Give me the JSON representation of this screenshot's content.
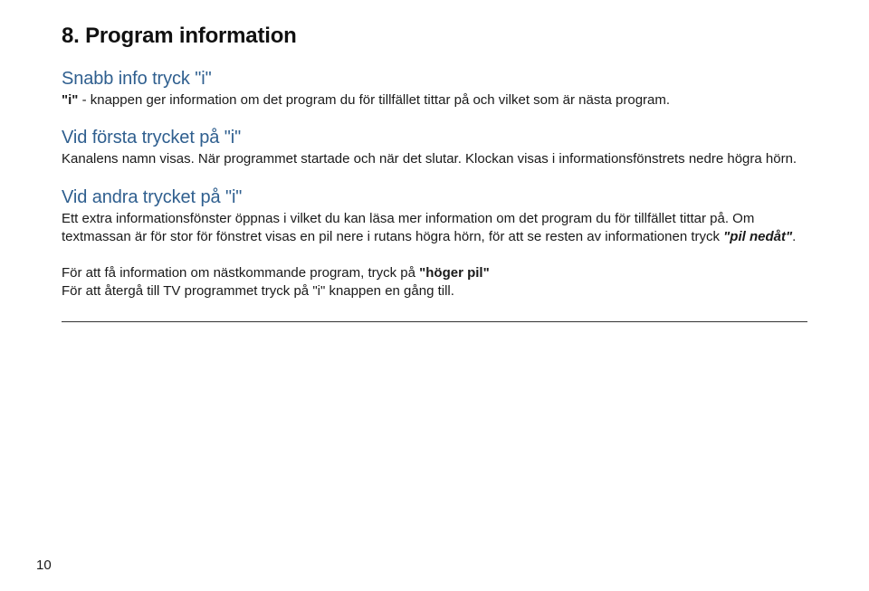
{
  "title": "8. Program information",
  "sections": [
    {
      "heading": "Snabb info tryck \"i\"",
      "body_prefix_bold": "\"i\"",
      "body_rest": " - knappen ger information om det program du för tillfället tittar på och vilket som är nästa program."
    },
    {
      "heading": "Vid första trycket på \"i\"",
      "body": "Kanalens namn visas. När programmet startade och när det slutar. Klockan visas i informationsfönstrets nedre högra hörn."
    },
    {
      "heading": "Vid andra trycket på \"i\"",
      "body_a": "Ett extra informationsfönster öppnas i vilket du kan läsa mer information om det program du för tillfället tittar på. Om textmassan är för stor för fönstret visas en pil nere i rutans högra hörn, för att se resten av informationen tryck ",
      "body_a_bold": "\"pil nedåt\"",
      "body_a_tail": ".",
      "line2_a": "För att få information om nästkommande program, tryck på ",
      "line2_bold": "\"höger pil\"",
      "line3": "För att återgå till TV programmet tryck på \"i\" knappen en gång till."
    }
  ],
  "page_number": "10"
}
